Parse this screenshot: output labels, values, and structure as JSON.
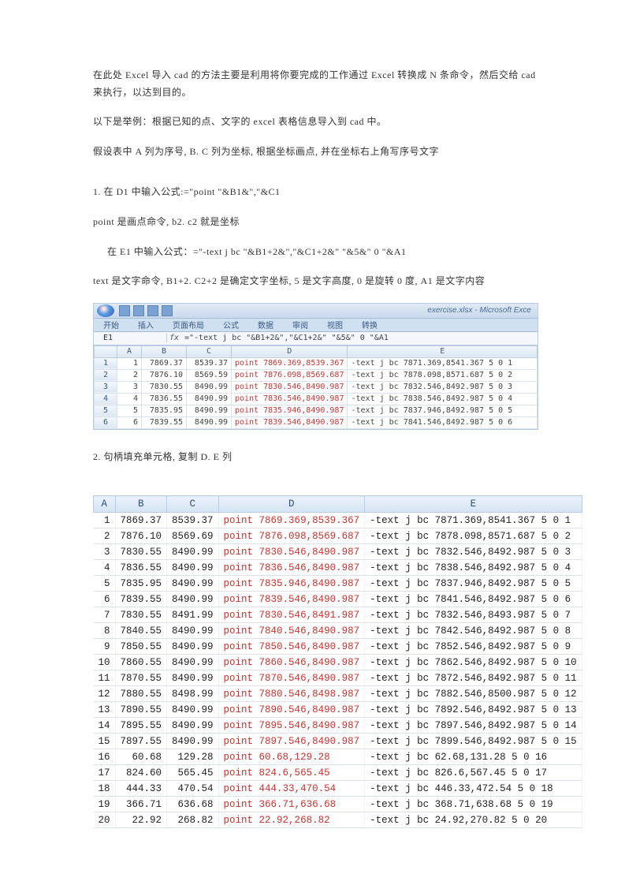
{
  "paragraphs": {
    "p1": "在此处 Excel 导入 cad 的方法主要是利用将你要完成的工作通过 Excel 转换成 N 条命令，然后交给 cad 来执行，以达到目的。",
    "p2": "以下是举例：根据已知的点、文字的 excel 表格信息导入到 cad 中。",
    "p3": "假设表中 A 列为序号, B. C 列为坐标, 根据坐标画点, 并在坐标右上角写序号文字",
    "p4": "1. 在 D1 中输入公式:=\"point \"&B1&\",\"&C1",
    "p5": "point 是画点命令, b2. c2 就是坐标",
    "p6": "在 E1 中输入公式：=\"-text j bc \"&B1+2&\",\"&C1+2&\" \"&5&\" 0 \"&A1",
    "p7": "text 是文字命令, B1+2. C2+2 是确定文字坐标, 5 是文字高度, 0 是旋转 0 度, A1 是文字内容",
    "p8": "2. 句柄填充单元格, 复制 D. E 列"
  },
  "blur_excel": {
    "title": "exercise.xlsx - Microsoft Exce",
    "tabs": [
      "开始",
      "插入",
      "页面布局",
      "公式",
      "数据",
      "审阅",
      "视图",
      "转换"
    ],
    "namebox": "E1",
    "formula": "=\"-text j bc \"&B1+2&\",\"&C1+2&\" \"&5&\" 0 \"&A1",
    "cols": [
      "",
      "A",
      "B",
      "C",
      "D",
      "E"
    ],
    "rows": [
      {
        "n": "1",
        "a": "1",
        "b": "7869.37",
        "c": "8539.37",
        "d": "point 7869.369,8539.367",
        "e": "-text j bc 7871.369,8541.367 5 0 1"
      },
      {
        "n": "2",
        "a": "2",
        "b": "7876.10",
        "c": "8569.59",
        "d": "point 7876.098,8569.687",
        "e": "-text j bc 7878.098,8571.687 5 0 2"
      },
      {
        "n": "3",
        "a": "3",
        "b": "7830.55",
        "c": "8490.99",
        "d": "point 7830.546,8490.987",
        "e": "-text j bc 7832.546,8492.987 5 0 3"
      },
      {
        "n": "4",
        "a": "4",
        "b": "7836.55",
        "c": "8490.99",
        "d": "point 7836.546,8490.987",
        "e": "-text j bc 7838.546,8492.987 5 0 4"
      },
      {
        "n": "5",
        "a": "5",
        "b": "7835.95",
        "c": "8490.99",
        "d": "point 7835.946,8490.987",
        "e": "-text j bc 7837.946,8492.987 5 0 5"
      },
      {
        "n": "6",
        "a": "6",
        "b": "7839.55",
        "c": "8490.99",
        "d": "point 7839.546,8490.987",
        "e": "-text j bc 7841.546,8492.987 5 0 6"
      }
    ]
  },
  "big_table": {
    "cols": [
      "A",
      "B",
      "C",
      "D",
      "E"
    ],
    "rows": [
      {
        "a": "1",
        "b": "7869.37",
        "c": "8539.37",
        "d": "point 7869.369,8539.367",
        "e": "-text j bc 7871.369,8541.367 5 0 1"
      },
      {
        "a": "2",
        "b": "7876.10",
        "c": "8569.69",
        "d": "point 7876.098,8569.687",
        "e": "-text j bc 7878.098,8571.687 5 0 2"
      },
      {
        "a": "3",
        "b": "7830.55",
        "c": "8490.99",
        "d": "point 7830.546,8490.987",
        "e": "-text j bc 7832.546,8492.987 5 0 3"
      },
      {
        "a": "4",
        "b": "7836.55",
        "c": "8490.99",
        "d": "point 7836.546,8490.987",
        "e": "-text j bc 7838.546,8492.987 5 0 4"
      },
      {
        "a": "5",
        "b": "7835.95",
        "c": "8490.99",
        "d": "point 7835.946,8490.987",
        "e": "-text j bc 7837.946,8492.987 5 0 5"
      },
      {
        "a": "6",
        "b": "7839.55",
        "c": "8490.99",
        "d": "point 7839.546,8490.987",
        "e": "-text j bc 7841.546,8492.987 5 0 6"
      },
      {
        "a": "7",
        "b": "7830.55",
        "c": "8491.99",
        "d": "point 7830.546,8491.987",
        "e": "-text j bc 7832.546,8493.987 5 0 7"
      },
      {
        "a": "8",
        "b": "7840.55",
        "c": "8490.99",
        "d": "point 7840.546,8490.987",
        "e": "-text j bc 7842.546,8492.987 5 0 8"
      },
      {
        "a": "9",
        "b": "7850.55",
        "c": "8490.99",
        "d": "point 7850.546,8490.987",
        "e": "-text j bc 7852.546,8492.987 5 0 9"
      },
      {
        "a": "10",
        "b": "7860.55",
        "c": "8490.99",
        "d": "point 7860.546,8490.987",
        "e": "-text j bc 7862.546,8492.987 5 0 10"
      },
      {
        "a": "11",
        "b": "7870.55",
        "c": "8490.99",
        "d": "point 7870.546,8490.987",
        "e": "-text j bc 7872.546,8492.987 5 0 11"
      },
      {
        "a": "12",
        "b": "7880.55",
        "c": "8498.99",
        "d": "point 7880.546,8498.987",
        "e": "-text j bc 7882.546,8500.987 5 0 12"
      },
      {
        "a": "13",
        "b": "7890.55",
        "c": "8490.99",
        "d": "point 7890.546,8490.987",
        "e": "-text j bc 7892.546,8492.987 5 0 13"
      },
      {
        "a": "14",
        "b": "7895.55",
        "c": "8490.99",
        "d": "point 7895.546,8490.987",
        "e": "-text j bc 7897.546,8492.987 5 0 14"
      },
      {
        "a": "15",
        "b": "7897.55",
        "c": "8490.99",
        "d": "point 7897.546,8490.987",
        "e": "-text j bc 7899.546,8492.987 5 0 15"
      },
      {
        "a": "16",
        "b": "60.68",
        "c": "129.28",
        "d": "point 60.68,129.28",
        "e": "-text j bc 62.68,131.28 5 0 16"
      },
      {
        "a": "17",
        "b": "824.60",
        "c": "565.45",
        "d": "point 824.6,565.45",
        "e": "-text j bc 826.6,567.45 5 0 17"
      },
      {
        "a": "18",
        "b": "444.33",
        "c": "470.54",
        "d": "point 444.33,470.54",
        "e": "-text j bc 446.33,472.54 5 0 18"
      },
      {
        "a": "19",
        "b": "366.71",
        "c": "636.68",
        "d": "point 366.71,636.68",
        "e": "-text j bc 368.71,638.68 5 0 19"
      },
      {
        "a": "20",
        "b": "22.92",
        "c": "268.82",
        "d": "point 22.92,268.82",
        "e": "-text j bc 24.92,270.82 5 0 20"
      }
    ]
  }
}
